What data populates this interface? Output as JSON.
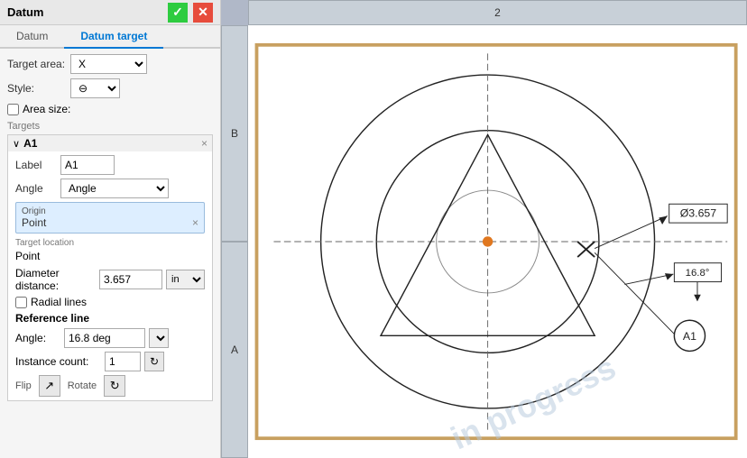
{
  "header": {
    "title": "Datum",
    "check_icon": "✓",
    "x_icon": "✕"
  },
  "tabs": [
    {
      "id": "datum",
      "label": "Datum",
      "active": false
    },
    {
      "id": "datum-target",
      "label": "Datum target",
      "active": true
    }
  ],
  "fields": {
    "target_area_label": "Target area:",
    "target_area_value": "X",
    "style_label": "Style:",
    "style_icon": "⊖",
    "area_size_label": "Area size:"
  },
  "targets_section": {
    "label": "Targets",
    "target_name": "A1",
    "label_label": "Label",
    "label_value": "A1",
    "angle_label": "Angle",
    "origin_label": "Origin",
    "origin_value": "Point",
    "target_location_label": "Target location",
    "target_location_value": "Point",
    "diameter_label": "Diameter distance:",
    "diameter_value": "3.657 in",
    "diameter_unit": "in",
    "radial_lines_label": "Radial lines",
    "reference_line_label": "Reference line",
    "angle_field_label": "Angle:",
    "angle_value": "16.8 deg",
    "instance_label": "Instance count:",
    "instance_value": "1",
    "flip_label": "Flip",
    "rotate_label": "Rotate"
  },
  "canvas": {
    "col_header": "2",
    "row_header_b": "B",
    "row_header_a": "A",
    "diameter_label": "Ø3.657",
    "angle_label": "16.8°",
    "target_label": "A1",
    "watermark": "in progress"
  }
}
